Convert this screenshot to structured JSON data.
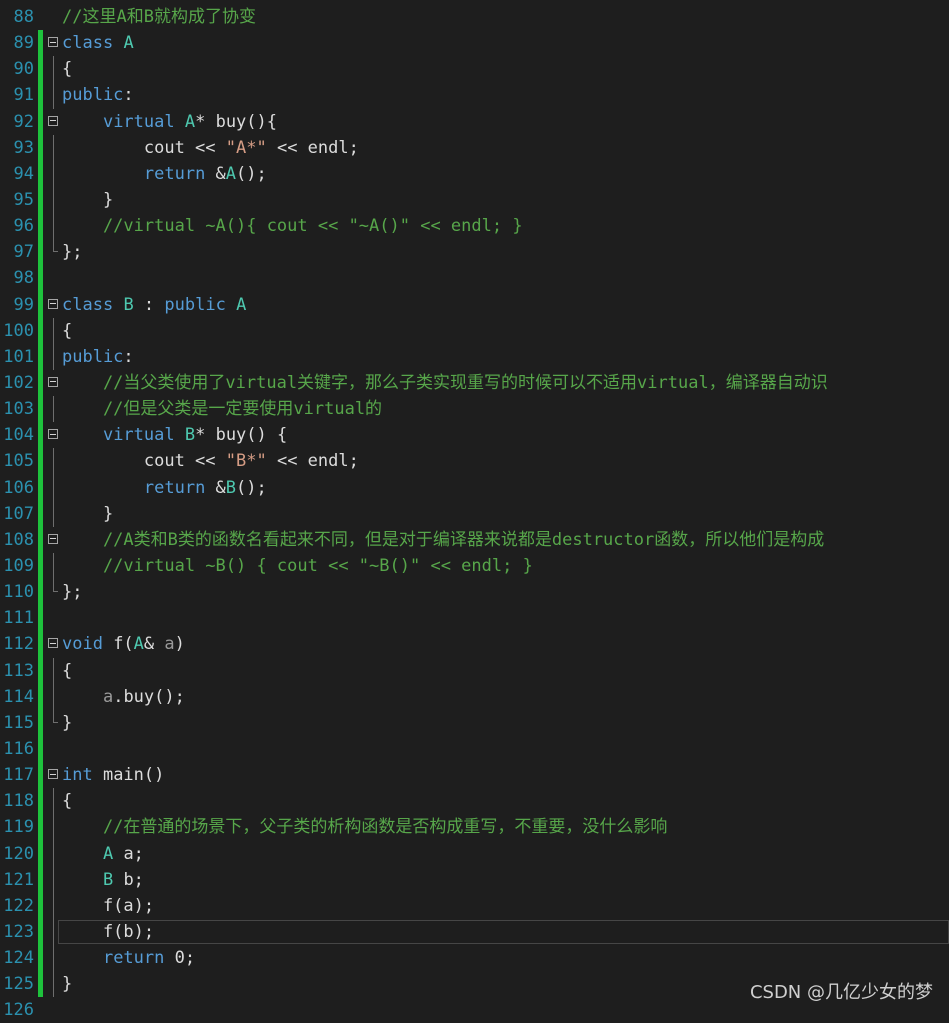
{
  "editor": {
    "lines": [
      {
        "n": "88",
        "tokens": [
          [
            "cm",
            "//这里A和B就构成了协变"
          ]
        ]
      },
      {
        "n": "89",
        "fold": true,
        "tokens": [
          [
            "kw",
            "class"
          ],
          [
            "pl",
            " "
          ],
          [
            "cls",
            "A"
          ]
        ]
      },
      {
        "n": "90",
        "tokens": [
          [
            "pl",
            "{"
          ]
        ]
      },
      {
        "n": "91",
        "tokens": [
          [
            "kw",
            "public"
          ],
          [
            "pl",
            ":"
          ]
        ]
      },
      {
        "n": "92",
        "fold": true,
        "tokens": [
          [
            "pl",
            "    "
          ],
          [
            "kw",
            "virtual"
          ],
          [
            "pl",
            " "
          ],
          [
            "cls",
            "A"
          ],
          [
            "pl",
            "* buy(){"
          ]
        ]
      },
      {
        "n": "93",
        "tokens": [
          [
            "pl",
            "        cout << "
          ],
          [
            "str",
            "\"A*\""
          ],
          [
            "pl",
            " << endl;"
          ]
        ]
      },
      {
        "n": "94",
        "tokens": [
          [
            "pl",
            "        "
          ],
          [
            "kw",
            "return"
          ],
          [
            "pl",
            " &"
          ],
          [
            "cls",
            "A"
          ],
          [
            "pl",
            "();"
          ]
        ]
      },
      {
        "n": "95",
        "tokens": [
          [
            "pl",
            "    }"
          ]
        ]
      },
      {
        "n": "96",
        "tokens": [
          [
            "cm",
            "    //virtual ~A(){ cout << \"~A()\" << endl; }"
          ]
        ]
      },
      {
        "n": "97",
        "tokens": [
          [
            "pl",
            "};"
          ]
        ]
      },
      {
        "n": "98",
        "tokens": []
      },
      {
        "n": "99",
        "fold": true,
        "tokens": [
          [
            "kw",
            "class"
          ],
          [
            "pl",
            " "
          ],
          [
            "cls",
            "B"
          ],
          [
            "pl",
            " : "
          ],
          [
            "kw",
            "public"
          ],
          [
            "pl",
            " "
          ],
          [
            "cls",
            "A"
          ]
        ]
      },
      {
        "n": "100",
        "tokens": [
          [
            "pl",
            "{"
          ]
        ]
      },
      {
        "n": "101",
        "tokens": [
          [
            "kw",
            "public"
          ],
          [
            "pl",
            ":"
          ]
        ]
      },
      {
        "n": "102",
        "fold": true,
        "tokens": [
          [
            "cm",
            "    //当父类使用了virtual关键字，那么子类实现重写的时候可以不适用virtual，编译器自动识"
          ]
        ]
      },
      {
        "n": "103",
        "tokens": [
          [
            "cm",
            "    //但是父类是一定要使用virtual的"
          ]
        ]
      },
      {
        "n": "104",
        "fold": true,
        "tokens": [
          [
            "pl",
            "    "
          ],
          [
            "kw",
            "virtual"
          ],
          [
            "pl",
            " "
          ],
          [
            "cls",
            "B"
          ],
          [
            "pl",
            "* buy() {"
          ]
        ]
      },
      {
        "n": "105",
        "tokens": [
          [
            "pl",
            "        cout << "
          ],
          [
            "str",
            "\"B*\""
          ],
          [
            "pl",
            " << endl;"
          ]
        ]
      },
      {
        "n": "106",
        "tokens": [
          [
            "pl",
            "        "
          ],
          [
            "kw",
            "return"
          ],
          [
            "pl",
            " &"
          ],
          [
            "cls",
            "B"
          ],
          [
            "pl",
            "();"
          ]
        ]
      },
      {
        "n": "107",
        "tokens": [
          [
            "pl",
            "    }"
          ]
        ]
      },
      {
        "n": "108",
        "fold": true,
        "tokens": [
          [
            "cm",
            "    //A类和B类的函数名看起来不同，但是对于编译器来说都是destructor函数，所以他们是构成"
          ]
        ]
      },
      {
        "n": "109",
        "tokens": [
          [
            "cm",
            "    //virtual ~B() { cout << \"~B()\" << endl; }"
          ]
        ]
      },
      {
        "n": "110",
        "tokens": [
          [
            "pl",
            "};"
          ]
        ]
      },
      {
        "n": "111",
        "tokens": []
      },
      {
        "n": "112",
        "fold": true,
        "tokens": [
          [
            "kw",
            "void"
          ],
          [
            "pl",
            " f("
          ],
          [
            "cls",
            "A"
          ],
          [
            "pl",
            "& "
          ],
          [
            "param",
            "a"
          ],
          [
            "pl",
            ")"
          ]
        ]
      },
      {
        "n": "113",
        "tokens": [
          [
            "pl",
            "{"
          ]
        ]
      },
      {
        "n": "114",
        "tokens": [
          [
            "pl",
            "    "
          ],
          [
            "param",
            "a"
          ],
          [
            "pl",
            ".buy();"
          ]
        ]
      },
      {
        "n": "115",
        "tokens": [
          [
            "pl",
            "}"
          ]
        ]
      },
      {
        "n": "116",
        "tokens": []
      },
      {
        "n": "117",
        "fold": true,
        "tokens": [
          [
            "kw",
            "int"
          ],
          [
            "pl",
            " main()"
          ]
        ]
      },
      {
        "n": "118",
        "tokens": [
          [
            "pl",
            "{"
          ]
        ]
      },
      {
        "n": "119",
        "tokens": [
          [
            "cm",
            "    //在普通的场景下，父子类的析构函数是否构成重写，不重要，没什么影响"
          ]
        ]
      },
      {
        "n": "120",
        "tokens": [
          [
            "pl",
            "    "
          ],
          [
            "cls",
            "A"
          ],
          [
            "pl",
            " a;"
          ]
        ]
      },
      {
        "n": "121",
        "tokens": [
          [
            "pl",
            "    "
          ],
          [
            "cls",
            "B"
          ],
          [
            "pl",
            " b;"
          ]
        ]
      },
      {
        "n": "122",
        "tokens": [
          [
            "pl",
            "    f(a);"
          ]
        ]
      },
      {
        "n": "123",
        "current": true,
        "tokens": [
          [
            "pl",
            "    f(b);"
          ]
        ]
      },
      {
        "n": "124",
        "tokens": [
          [
            "pl",
            "    "
          ],
          [
            "kw",
            "return"
          ],
          [
            "pl",
            " 0;"
          ]
        ]
      },
      {
        "n": "125",
        "tokens": [
          [
            "pl",
            "}"
          ]
        ]
      },
      {
        "n": "126",
        "tokens": []
      }
    ]
  },
  "watermark": "CSDN @几亿少女的梦",
  "colors": {
    "background": "#1e1e1e",
    "line_number": "#2b91af",
    "keyword": "#569cd6",
    "type": "#4ec9b0",
    "string": "#d69d85",
    "comment": "#57a64a",
    "change_bar": "#1ec23c"
  }
}
